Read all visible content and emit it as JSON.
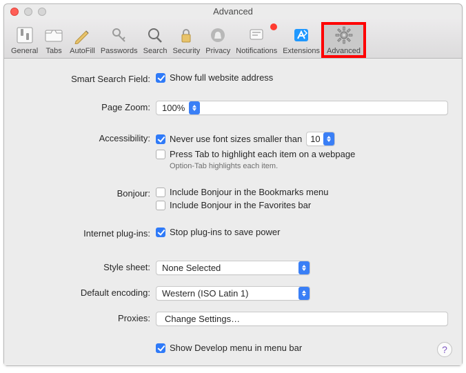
{
  "window": {
    "title": "Advanced"
  },
  "toolbar": {
    "items": [
      {
        "label": "General"
      },
      {
        "label": "Tabs"
      },
      {
        "label": "AutoFill"
      },
      {
        "label": "Passwords"
      },
      {
        "label": "Search"
      },
      {
        "label": "Security"
      },
      {
        "label": "Privacy"
      },
      {
        "label": "Notifications"
      },
      {
        "label": "Extensions"
      },
      {
        "label": "Advanced"
      }
    ]
  },
  "labels": {
    "smart_search": "Smart Search Field:",
    "page_zoom": "Page Zoom:",
    "accessibility": "Accessibility:",
    "bonjour": "Bonjour:",
    "plugins": "Internet plug-ins:",
    "stylesheet": "Style sheet:",
    "encoding": "Default encoding:",
    "proxies": "Proxies:"
  },
  "options": {
    "show_full_address": "Show full website address",
    "never_font_smaller": "Never use font sizes smaller than",
    "press_tab": "Press Tab to highlight each item on a webpage",
    "option_tab_hint": "Option-Tab highlights each item.",
    "bonjour_bookmarks": "Include Bonjour in the Bookmarks menu",
    "bonjour_favorites": "Include Bonjour in the Favorites bar",
    "stop_plugins": "Stop plug-ins to save power",
    "show_develop": "Show Develop menu in menu bar"
  },
  "values": {
    "zoom": "100%",
    "min_font": "10",
    "stylesheet": "None Selected",
    "encoding": "Western (ISO Latin 1)",
    "proxies_btn": "Change Settings…"
  },
  "help": "?"
}
